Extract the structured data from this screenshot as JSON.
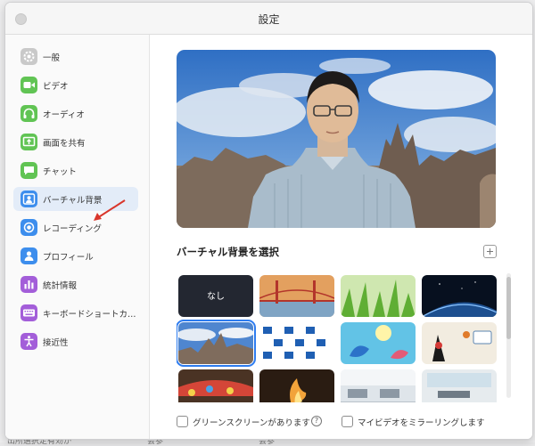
{
  "window": {
    "title": "設定"
  },
  "sidebar": {
    "items": [
      {
        "label": "一般",
        "icon": "gear-icon",
        "color": "#c9c9c9"
      },
      {
        "label": "ビデオ",
        "icon": "video-camera-icon",
        "color": "#61c454"
      },
      {
        "label": "オーディオ",
        "icon": "headphones-icon",
        "color": "#61c454"
      },
      {
        "label": "画面を共有",
        "icon": "share-screen-icon",
        "color": "#61c454"
      },
      {
        "label": "チャット",
        "icon": "chat-bubble-icon",
        "color": "#61c454"
      },
      {
        "label": "バーチャル背景",
        "icon": "person-background-icon",
        "color": "#3d8eed",
        "selected": true
      },
      {
        "label": "レコーディング",
        "icon": "record-icon",
        "color": "#3d8eed"
      },
      {
        "label": "プロフィール",
        "icon": "person-icon",
        "color": "#3d8eed"
      },
      {
        "label": "統計情報",
        "icon": "bar-chart-icon",
        "color": "#a35ed9"
      },
      {
        "label": "キーボードショートカ…",
        "icon": "keyboard-icon",
        "color": "#a35ed9"
      },
      {
        "label": "接近性",
        "icon": "accessibility-icon",
        "color": "#a35ed9"
      }
    ]
  },
  "virtual_background": {
    "section_title": "バーチャル背景を選択",
    "none_label": "なし",
    "thumbnails": [
      "none",
      "golden-gate-bridge",
      "green-grass",
      "earth-from-space",
      "themed-city-selected",
      "blue-logo-pattern",
      "illustrated-sea-animals",
      "java-duke-mascot",
      "amusement-ride",
      "campfire",
      "office-room",
      "office-room-2"
    ],
    "green_screen_label": "グリーンスクリーンがあります",
    "mirror_label": "マイビデオをミラーリングします"
  },
  "background_window": {
    "texts": [
      "出所選択定有効か",
      "会参",
      "会参"
    ]
  },
  "colors": {
    "accent": "#2d7cf0",
    "selected_bg": "#e3ecf8",
    "annotation_arrow": "#d9362b"
  }
}
